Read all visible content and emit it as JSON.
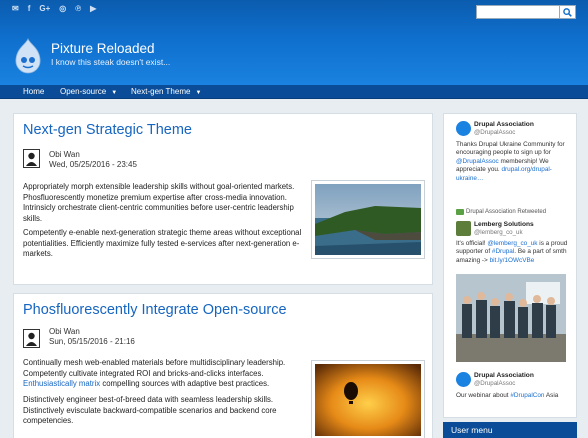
{
  "social_icons": [
    "envelope-icon",
    "facebook-icon",
    "google-plus-icon",
    "instagram-icon",
    "pinterest-icon",
    "youtube-icon"
  ],
  "social_glyphs": [
    "✉",
    "f",
    "G+",
    "◎",
    "℗",
    "▶"
  ],
  "search": {
    "value": "",
    "icon": "search-icon"
  },
  "site": {
    "name": "Pixture Reloaded",
    "slogan": "I know this steak doesn't exist..."
  },
  "nav": [
    {
      "label": "Home",
      "has_dropdown": false
    },
    {
      "label": "Open-source",
      "has_dropdown": true
    },
    {
      "label": "Next-gen Theme",
      "has_dropdown": true
    }
  ],
  "articles": [
    {
      "title": "Next-gen Strategic Theme",
      "author": "Obi Wan",
      "date": "Wed, 05/25/2016 - 23:45",
      "p1": "Appropriately morph extensible leadership skills without goal-oriented markets. Phosfluorescently monetize premium expertise after cross-media innovation. Intrinsicly orchestrate client-centric communities before user-centric leadership skills.",
      "p2": "Competently e-enable next-generation strategic theme areas without exceptional potentialities. Efficiently maximize fully tested e-services after next-generation e-markets."
    },
    {
      "title": "Phosfluorescently Integrate Open-source",
      "author": "Obi Wan",
      "date": "Sun, 05/15/2016 - 21:16",
      "p1_before": "Continually mesh web-enabled materials before multidisciplinary leadership. Competently cultivate integrated ROI and bricks-and-clicks interfaces.",
      "p1_link": "Enthusiastically matrix",
      "p1_after": "compelling sources with adaptive best practices.",
      "p2": "Distinctively engineer best-of-breed data with seamless leadership skills. Distinctively evisculate backward-compatible scenarios and backend core competencies."
    }
  ],
  "twitter": {
    "t1": {
      "name": "Drupal Association",
      "handle": "@DrupalAssoc",
      "text_before": "Thanks Drupal Ukraine Community for encouraging people to sign up for",
      "mention": "@DrupalAssoc",
      "text_mid": "membership! We appreciate you.",
      "link": "drupal.org/drupal-ukraine…"
    },
    "retweeted": "Drupal Association Retweeted",
    "t2": {
      "name": "Lemberg Solutions",
      "handle": "@lemberg_co_uk",
      "text_before": "It's official!",
      "mention": "@lemberg_co_uk",
      "text_mid": "is a proud supporter of",
      "hashtag": "#Drupal",
      "text_mid2": ". Be a part of smth amazing ->",
      "link": "bit.ly/1OWcVBe"
    },
    "t3": {
      "name": "Drupal Association",
      "handle": "@DrupalAssoc",
      "text_before": "Our webinar about",
      "hashtag": "#DrupalCon",
      "text_after": "Asia"
    }
  },
  "user_menu": {
    "title": "User menu"
  },
  "colors": {
    "header": "#0f6fcd",
    "nav": "#0a4c97",
    "link": "#1665c1"
  }
}
